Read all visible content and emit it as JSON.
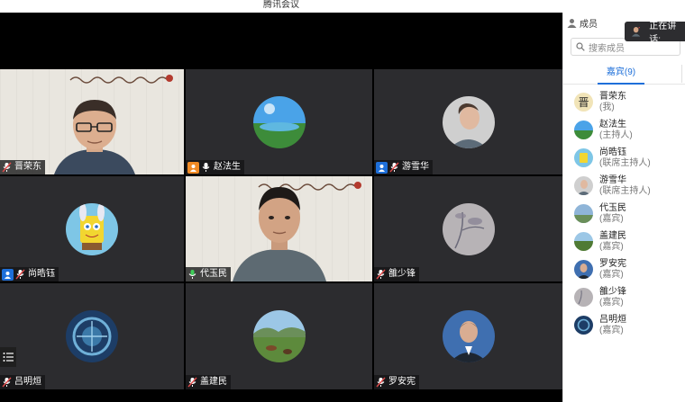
{
  "window": {
    "title": "腾讯会议"
  },
  "panel": {
    "header_label": "成员",
    "search_placeholder": "搜索成员",
    "tab_label": "嘉宾(9)",
    "members": [
      {
        "name": "晋荣东",
        "role": "(我)"
      },
      {
        "name": "赵法生",
        "role": "(主持人)"
      },
      {
        "name": "尚晧钰",
        "role": "(联席主持人)"
      },
      {
        "name": "游雪华",
        "role": "(联席主持人)"
      },
      {
        "name": "代玉民",
        "role": "(嘉宾)"
      },
      {
        "name": "盖建民",
        "role": "(嘉宾)"
      },
      {
        "name": "罗安宪",
        "role": "(嘉宾)"
      },
      {
        "name": "雒少锋",
        "role": "(嘉宾)"
      },
      {
        "name": "吕明烜",
        "role": "(嘉宾)"
      }
    ]
  },
  "speaking_indicator": {
    "label": "正在讲话:"
  },
  "grid": {
    "tiles": [
      {
        "name": "晋荣东"
      },
      {
        "name": "赵法生"
      },
      {
        "name": "游雪华"
      },
      {
        "name": "尚晧钰"
      },
      {
        "name": "代玉民"
      },
      {
        "name": "雒少锋"
      },
      {
        "name": "吕明烜"
      },
      {
        "name": "盖建民"
      },
      {
        "name": "罗安宪"
      }
    ]
  },
  "colors": {
    "accent": "#1e6fd9",
    "host_badge": "#f08a24",
    "tile_bg": "#2c2c2f"
  }
}
